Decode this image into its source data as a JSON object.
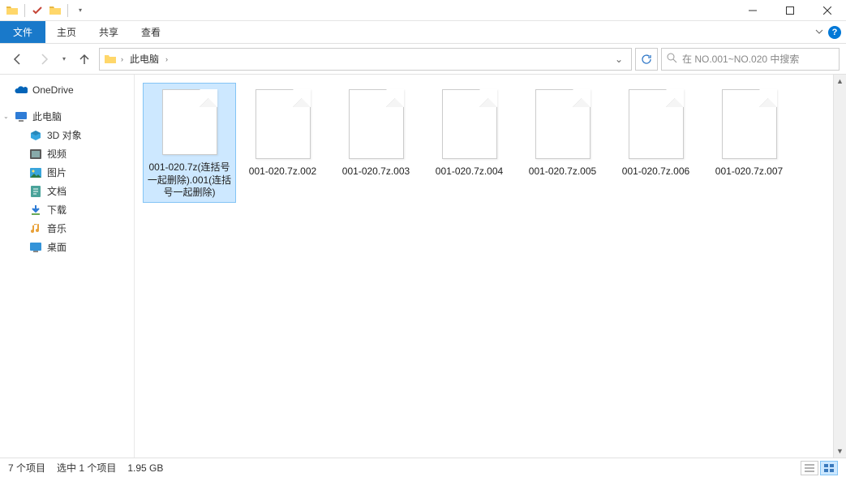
{
  "titlebar": {
    "qat": {
      "folder": true,
      "check": true
    }
  },
  "ribbon": {
    "file_tab": "文件",
    "tabs": [
      "主页",
      "共享",
      "查看"
    ]
  },
  "navigation": {
    "breadcrumb": [
      "此电脑"
    ],
    "search_placeholder": "在 NO.001~NO.020 中搜索"
  },
  "sidebar": {
    "top": [
      {
        "label": "OneDrive",
        "icon": "onedrive"
      }
    ],
    "pc_label": "此电脑",
    "pc_children": [
      {
        "label": "3D 对象",
        "icon": "3d"
      },
      {
        "label": "视频",
        "icon": "video"
      },
      {
        "label": "图片",
        "icon": "pictures"
      },
      {
        "label": "文档",
        "icon": "documents"
      },
      {
        "label": "下载",
        "icon": "downloads"
      },
      {
        "label": "音乐",
        "icon": "music"
      },
      {
        "label": "桌面",
        "icon": "desktop"
      }
    ]
  },
  "files": [
    {
      "name": "001-020.7z(连括号一起删除).001(连括号一起删除)",
      "selected": true
    },
    {
      "name": "001-020.7z.002",
      "selected": false
    },
    {
      "name": "001-020.7z.003",
      "selected": false
    },
    {
      "name": "001-020.7z.004",
      "selected": false
    },
    {
      "name": "001-020.7z.005",
      "selected": false
    },
    {
      "name": "001-020.7z.006",
      "selected": false
    },
    {
      "name": "001-020.7z.007",
      "selected": false
    }
  ],
  "status": {
    "count": "7 个项目",
    "selection": "选中 1 个项目",
    "size": "1.95 GB"
  }
}
